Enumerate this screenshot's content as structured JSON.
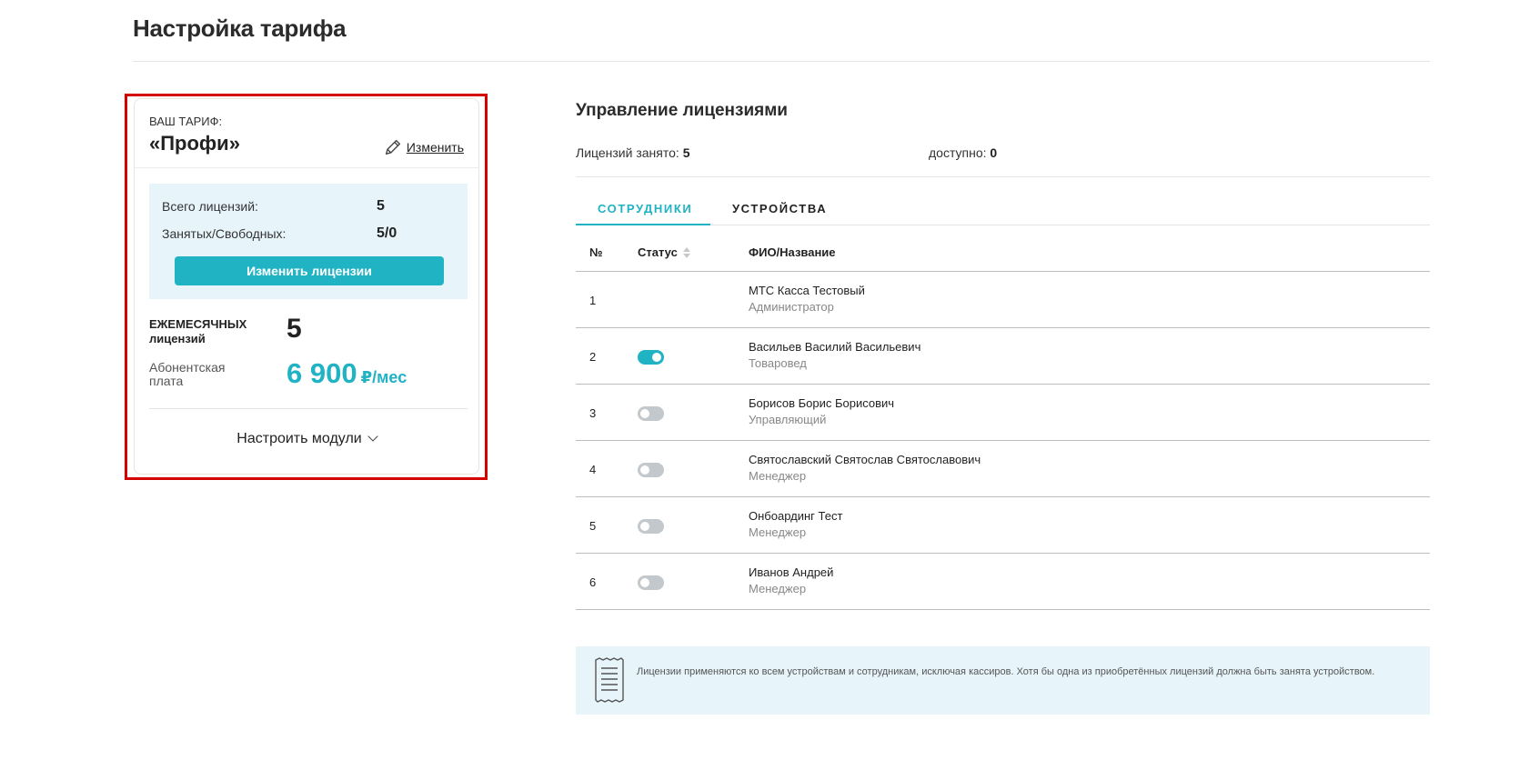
{
  "page": {
    "title": "Настройка тарифа"
  },
  "tariff": {
    "label": "ВАШ ТАРИФ:",
    "name": "«Профи»",
    "edit_label": "Изменить",
    "total_licenses_label": "Всего лицензий:",
    "total_licenses_value": "5",
    "occupied_free_label": "Занятых/Свободных:",
    "occupied_free_value": "5/0",
    "change_licenses_button": "Изменить лицензии",
    "monthly_label_top": "ЕЖЕМЕСЯЧНЫХ",
    "monthly_label_bottom": "лицензий",
    "monthly_value": "5",
    "fee_label": "Абонентская плата",
    "fee_amount": "6 900",
    "fee_unit": "₽/мес",
    "configure_modules": "Настроить модули"
  },
  "licenses": {
    "title": "Управление лицензиями",
    "occupied_label": "Лицензий занято:",
    "occupied_value": "5",
    "available_label": "доступно:",
    "available_value": "0",
    "tabs": [
      {
        "label": "СОТРУДНИКИ",
        "active": true
      },
      {
        "label": "УСТРОЙСТВА",
        "active": false
      }
    ],
    "columns": {
      "num": "№",
      "status": "Статус",
      "name": "ФИО/Название"
    },
    "rows": [
      {
        "num": "1",
        "status": null,
        "name": "МТС Касса Тестовый",
        "role": "Администратор"
      },
      {
        "num": "2",
        "status": "on",
        "name": "Васильев Василий Васильевич",
        "role": "Товаровед"
      },
      {
        "num": "3",
        "status": "off",
        "name": "Борисов Борис Борисович",
        "role": "Управляющий"
      },
      {
        "num": "4",
        "status": "off",
        "name": "Святославский Святослав Святославович",
        "role": "Менеджер"
      },
      {
        "num": "5",
        "status": "off",
        "name": "Онбоардинг Тест",
        "role": "Менеджер"
      },
      {
        "num": "6",
        "status": "off",
        "name": "Иванов Андрей",
        "role": "Менеджер"
      }
    ],
    "note": "Лицензии применяются ко всем устройствам и сотрудникам, исключая кассиров. Хотя бы одна из приобретённых лицензий должна быть занята устройством."
  },
  "colors": {
    "accent": "#20b3c4",
    "highlight_frame": "#d40000",
    "info_bg": "#e7f5fb"
  },
  "icons": {
    "edit": "pencil-icon",
    "modules": "chevron-down-icon",
    "sort": "sort-icon",
    "note": "receipt-icon"
  }
}
